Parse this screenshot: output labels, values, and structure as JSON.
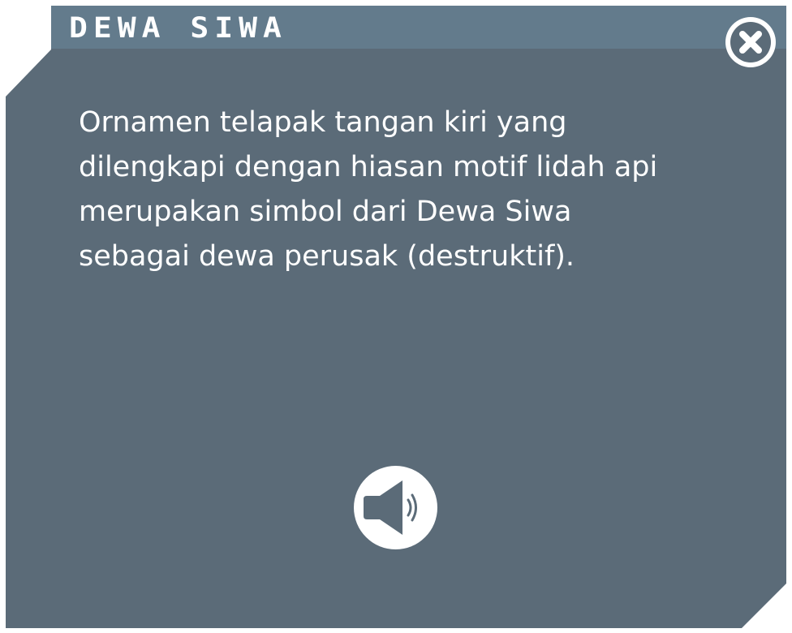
{
  "dialog": {
    "title": "DEWA SIWA",
    "description_lines": [
      "Ornamen telapak tangan kiri yang",
      "dilengkapi dengan hiasan motif lidah api",
      "merupakan simbol dari Dewa Siwa",
      "sebagai dewa perusak (destruktif)."
    ],
    "close_icon": "close-icon",
    "audio_icon": "speaker-icon"
  },
  "colors": {
    "panel": "#5b6b78",
    "title_bar": "#637b8c",
    "text": "#ffffff",
    "icon_bg": "#ffffff"
  }
}
